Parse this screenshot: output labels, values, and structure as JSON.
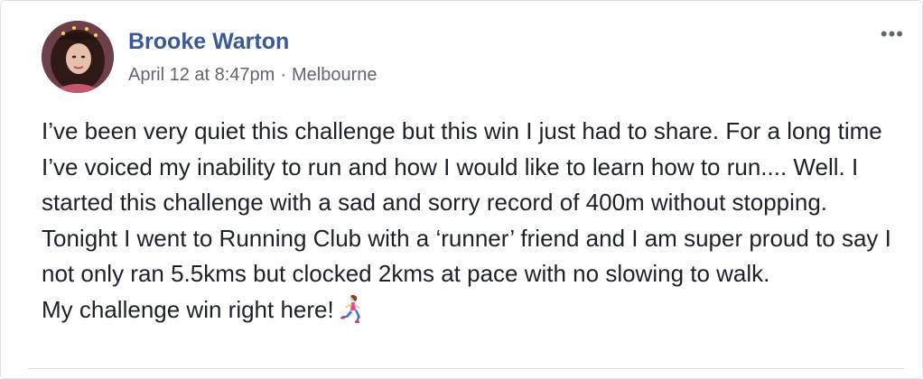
{
  "post": {
    "author": "Brooke Warton",
    "timestamp": "April 12 at 8:47pm",
    "separator": "·",
    "location": "Melbourne",
    "more_label": "•••",
    "paragraph": "I’ve been very quiet this challenge but this win I just had to share. For a long time I’ve voiced my inability to run and how I would like to learn how to run.... Well. I started this challenge with a sad and sorry record of 400m without stopping. Tonight I went to Running Club with a ‘runner’ friend and I am super proud to say I not only ran 5.5kms but clocked 2kms at pace with no slowing to walk.",
    "closing_line": "My challenge win right here!",
    "emoji_icon": "woman-running-icon"
  },
  "colors": {
    "author": "#385898",
    "meta": "#616770",
    "text": "#1d2129",
    "divider": "#dadde1"
  }
}
